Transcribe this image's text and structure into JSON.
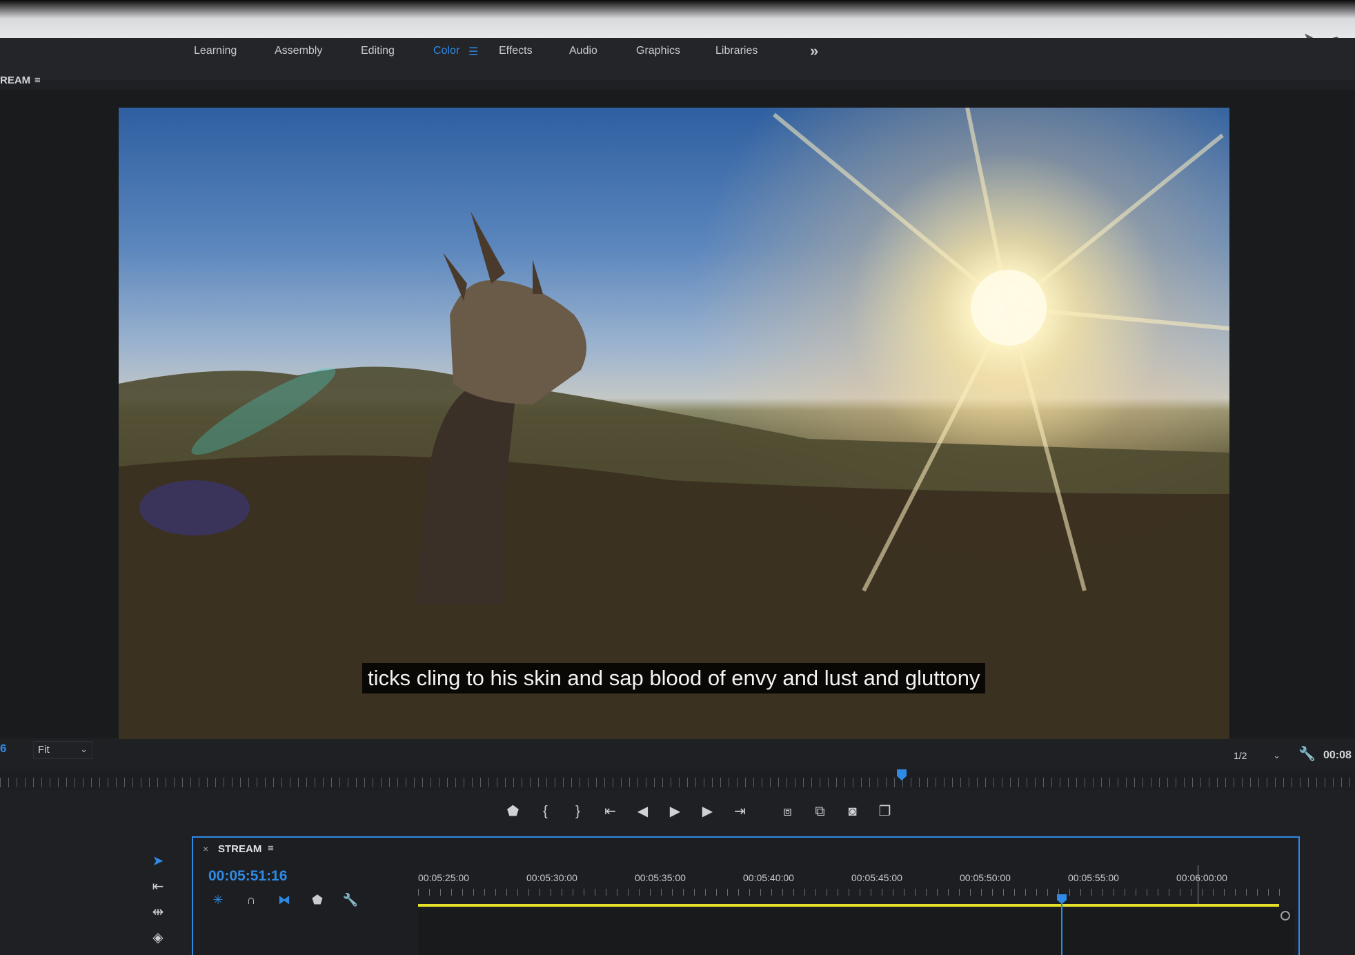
{
  "workspaces": {
    "tabs": [
      "Learning",
      "Assembly",
      "Editing",
      "Color",
      "Effects",
      "Audio",
      "Graphics",
      "Libraries"
    ],
    "active": "Color",
    "menu_icon": "hamburger-icon",
    "more_icon": "double-chevron-right-icon"
  },
  "program": {
    "panel_label": "REAM",
    "panel_menu": "≡",
    "subtitle": "ticks cling to his skin and sap blood of envy and lust and gluttony",
    "left_value": "6",
    "fit": "Fit",
    "resolution": "1/2",
    "timecode_right": "00:08"
  },
  "transport": {
    "buttons": [
      "add-marker",
      "mark-in",
      "mark-out",
      "go-to-in",
      "step-back",
      "play",
      "step-forward",
      "go-to-out",
      "insert",
      "overwrite",
      "export-frame",
      "comparison-view"
    ]
  },
  "timeline": {
    "close": "×",
    "title": "STREAM",
    "menu": "≡",
    "timecode": "00:05:51:16",
    "ruler_labels": [
      "00:05:25:00",
      "00:05:30:00",
      "00:05:35:00",
      "00:05:40:00",
      "00:05:45:00",
      "00:05:50:00",
      "00:05:55:00",
      "00:06:00:00"
    ]
  },
  "colors": {
    "accent": "#2f8ae6",
    "workarea": "#e6e02a",
    "panel_bg": "#1c1e21"
  }
}
